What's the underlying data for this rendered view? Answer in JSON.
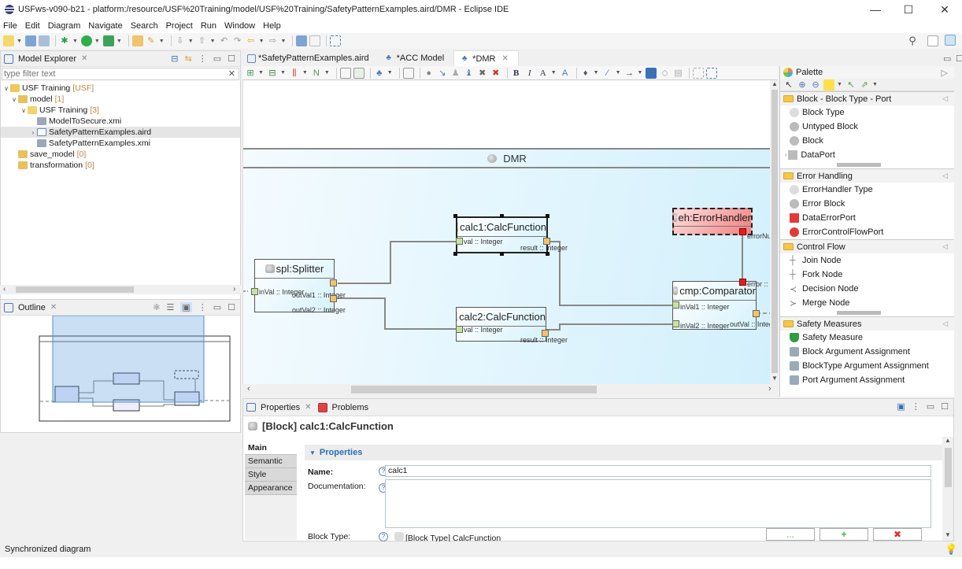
{
  "window": {
    "title": "USFws-v090-b21 - platform:/resource/USF%20Training/model/USF%20Training/SafetyPatternExamples.aird/DMR - Eclipse IDE",
    "minimize": "—",
    "maximize": "☐",
    "close": "✕"
  },
  "menu": [
    "File",
    "Edit",
    "Diagram",
    "Navigate",
    "Search",
    "Project",
    "Run",
    "Window",
    "Help"
  ],
  "explorer": {
    "title": "Model Explorer",
    "filter_placeholder": "type filter text",
    "tree": [
      {
        "label": "USF Training",
        "count": "[USF]",
        "depth": 0,
        "expanded": true,
        "icon": "project-icon"
      },
      {
        "label": "model",
        "count": "[1]",
        "depth": 1,
        "expanded": true,
        "icon": "folder-icon"
      },
      {
        "label": "USF Training",
        "count": "[3]",
        "depth": 2,
        "expanded": true,
        "icon": "folder-icon"
      },
      {
        "label": "ModelToSecure.xmi",
        "count": "",
        "depth": 3,
        "icon": "model-file-icon"
      },
      {
        "label": "SafetyPatternExamples.aird",
        "count": "",
        "depth": 3,
        "collapsed": true,
        "selected": true,
        "icon": "aird-file-icon"
      },
      {
        "label": "SafetyPatternExamples.xmi",
        "count": "",
        "depth": 3,
        "icon": "model-file-icon"
      },
      {
        "label": "save_model",
        "count": "[0]",
        "depth": 1,
        "icon": "folder-icon"
      },
      {
        "label": "transformation",
        "count": "[0]",
        "depth": 1,
        "icon": "folder-icon"
      }
    ]
  },
  "outline": {
    "title": "Outline"
  },
  "editor": {
    "tabs": [
      {
        "label": "*SafetyPatternExamples.aird",
        "active": false
      },
      {
        "label": "*ACC Model",
        "active": false
      },
      {
        "label": "*DMR",
        "active": true
      }
    ]
  },
  "diagram": {
    "container_title": "DMR",
    "blocks": {
      "splitter": {
        "title": "spl:Splitter",
        "ports": {
          "in": "inVal :: Integer",
          "out1": "outVal1 :: Integer",
          "out2": "outVal2 :: Integer"
        }
      },
      "calc1": {
        "title": "calc1:CalcFunction",
        "ports": {
          "in": "val :: Integer",
          "out": "result :: Integer"
        }
      },
      "calc2": {
        "title": "calc2:CalcFunction",
        "ports": {
          "in": "val :: Integer",
          "out": "result :: Integer"
        }
      },
      "errhandler": {
        "title": "eh:ErrorHandler",
        "ports": {
          "err": "errorNu"
        }
      },
      "comparator": {
        "title": "cmp:Comparator",
        "ports": {
          "err": "error :: I",
          "in1": "inVal1 :: Integer",
          "in2": "inVal2 :: Integer",
          "out": "outVal :: Integ"
        }
      }
    }
  },
  "palette": {
    "title": "Palette",
    "drawers": [
      {
        "title": "Block - Block Type - Port",
        "items": [
          "Block Type",
          "Untyped Block",
          "Block",
          "DataPort"
        ]
      },
      {
        "title": "Error Handling",
        "items": [
          "ErrorHandler Type",
          "Error Block",
          "DataErrorPort",
          "ErrorControlFlowPort"
        ]
      },
      {
        "title": "Control Flow",
        "items": [
          "Join Node",
          "Fork Node",
          "Decision Node",
          "Merge Node"
        ]
      },
      {
        "title": "Safety Measures",
        "items": [
          "Safety Measure",
          "Block Argument Assignment",
          "BlockType Argument Assignment",
          "Port Argument Assignment"
        ]
      }
    ]
  },
  "properties": {
    "tabs": [
      "Properties",
      "Problems"
    ],
    "header": "[Block] calc1:CalcFunction",
    "side_tabs": [
      "Main",
      "Semantic",
      "Style",
      "Appearance"
    ],
    "section": "Properties",
    "fields": {
      "name_label": "Name:",
      "name_value": "calc1",
      "doc_label": "Documentation:",
      "doc_value": "",
      "blocktype_label": "Block Type:",
      "blocktype_value": "[Block Type] CalcFunction"
    },
    "buttons": {
      "browse": "...",
      "add": "+",
      "remove": "✖"
    }
  },
  "status": {
    "message": "Synchronized diagram"
  }
}
